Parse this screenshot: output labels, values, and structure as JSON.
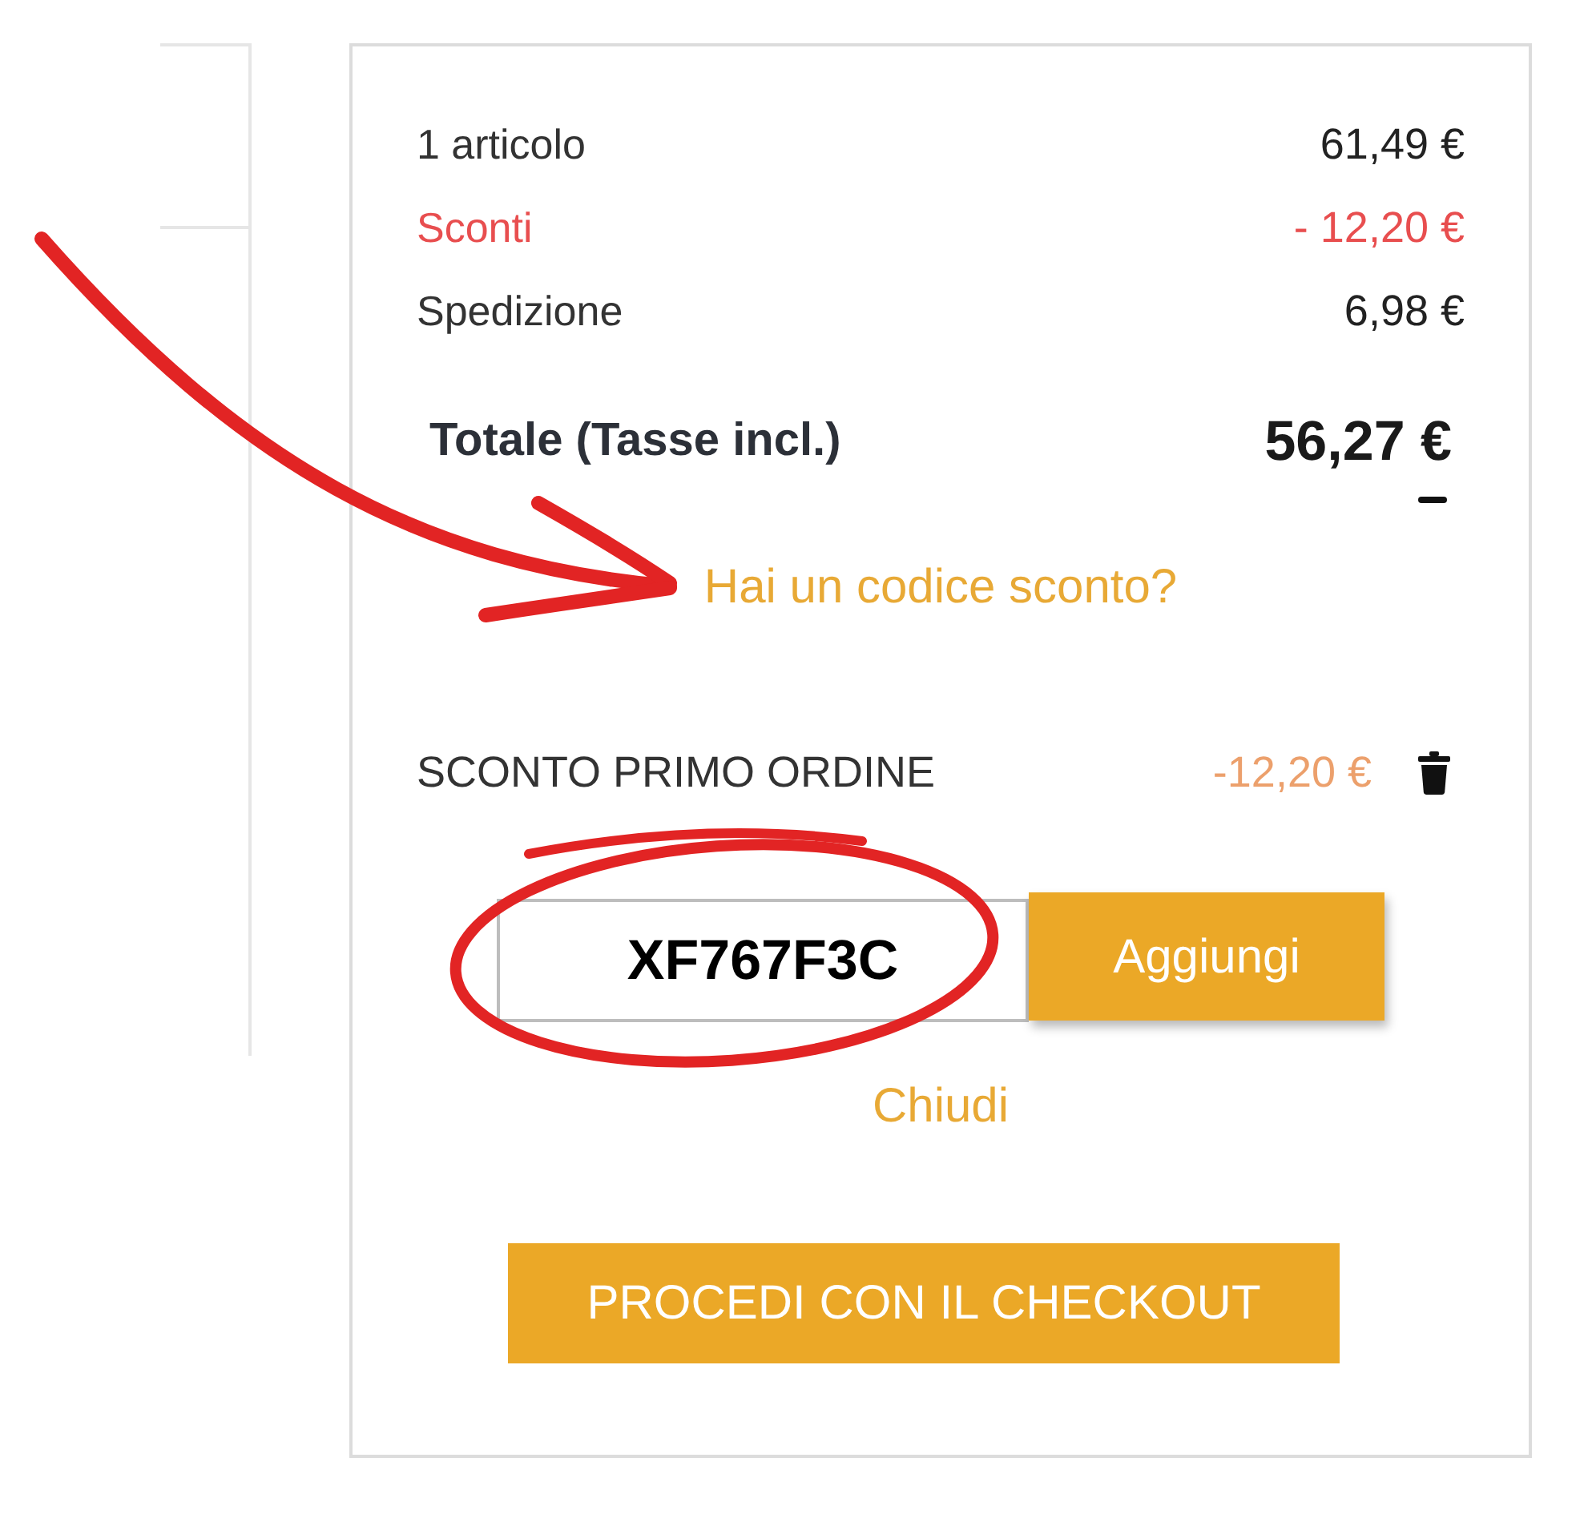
{
  "summary": {
    "rows": [
      {
        "kind": "normal",
        "label": "1 articolo",
        "value": "61,49 €"
      },
      {
        "kind": "discount",
        "label": "Sconti",
        "value": "- 12,20 €"
      },
      {
        "kind": "normal",
        "label": "Spedizione",
        "value": "6,98 €"
      }
    ],
    "total": {
      "label": "Totale (Tasse incl.)",
      "value": "56,27 €"
    }
  },
  "discount_link": "Hai un codice sconto?",
  "applied_codes": [
    {
      "name": "SCONTO PRIMO ORDINE",
      "amount": "-12,20 €"
    }
  ],
  "code_field": {
    "value": "XF767F3C"
  },
  "add_button": "Aggiungi",
  "close_link": "Chiudi",
  "checkout_button": "PROCEDI CON IL CHECKOUT"
}
